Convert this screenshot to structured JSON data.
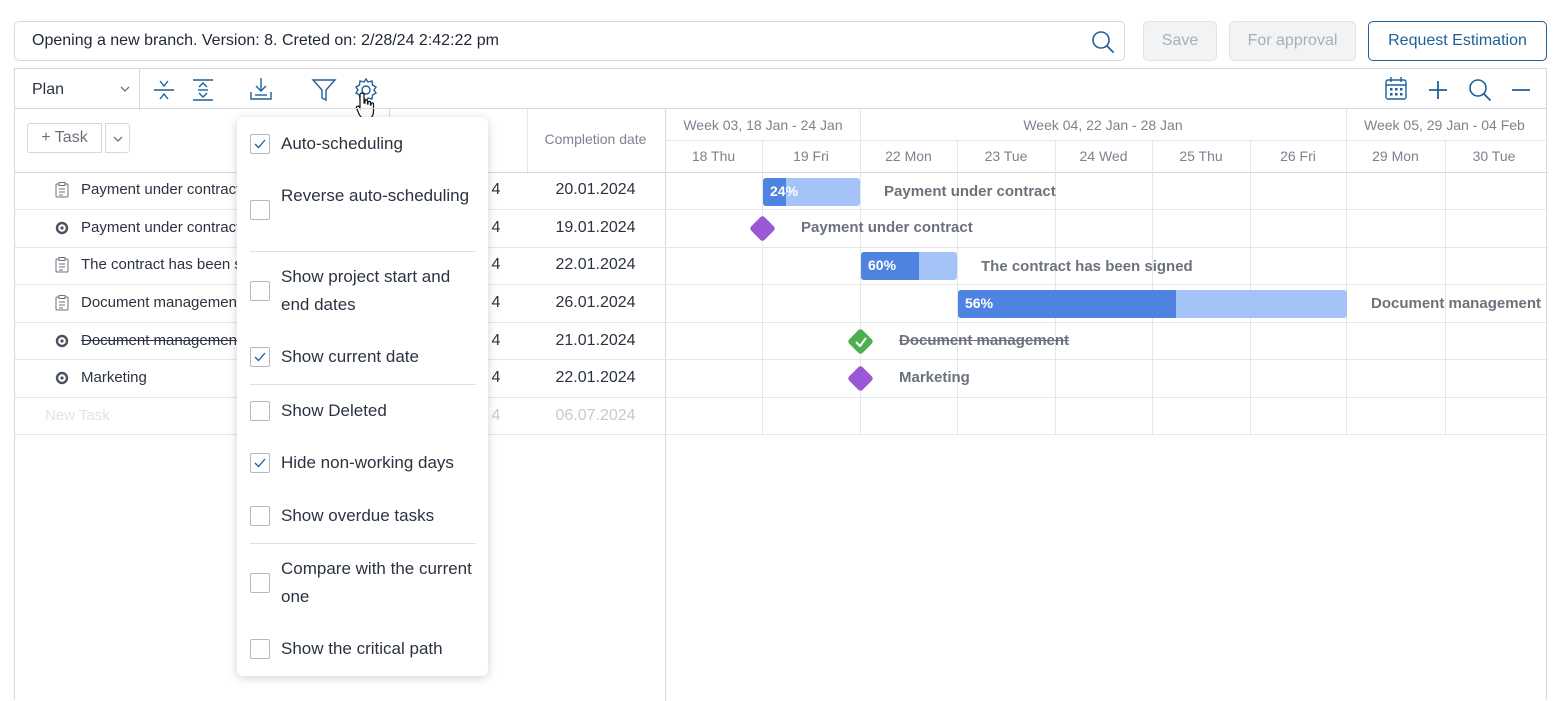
{
  "header": {
    "title_text": "Opening a new branch.  Version: 8.  Creted on: 2/28/24 2:42:22 pm",
    "save_label": "Save",
    "approval_label": "For approval",
    "estimation_label": "Request Estimation"
  },
  "toolbar": {
    "view_select": "Plan"
  },
  "table": {
    "add_task_label": "+ Task",
    "completion_header": "Completion date",
    "rows": [
      {
        "title": "Payment under contract",
        "icon": "task-icon",
        "start_tail": "4",
        "completion": "20.01.2024"
      },
      {
        "title": "Payment under contract",
        "icon": "milestone-icon",
        "start_tail": "4",
        "completion": "19.01.2024"
      },
      {
        "title": "The contract has been s",
        "icon": "task-icon",
        "start_tail": "4",
        "completion": "22.01.2024"
      },
      {
        "title": "Document managemen",
        "icon": "task-icon",
        "start_tail": "4",
        "completion": "26.01.2024"
      },
      {
        "title": "Document managemen",
        "icon": "milestone-icon",
        "start_tail": "4",
        "completion": "21.01.2024",
        "strike": true
      },
      {
        "title": "Marketing",
        "icon": "milestone-icon",
        "start_tail": "4",
        "completion": "22.01.2024"
      }
    ],
    "new_task": {
      "title": "New Task",
      "start_tail": "4",
      "completion": "06.07.2024"
    }
  },
  "gantt": {
    "weeks": [
      "Week 03, 18 Jan - 24 Jan",
      "Week 04, 22 Jan - 28 Jan",
      "Week 05, 29 Jan - 04 Feb"
    ],
    "days": [
      "18 Thu",
      "19 Fri",
      "22 Mon",
      "23 Tue",
      "24 Wed",
      "25 Thu",
      "26 Fri",
      "29 Mon",
      "30 Tue"
    ],
    "bars": [
      {
        "label": "Payment under contract",
        "percent": "24%",
        "progress": 0.24
      },
      {
        "label": "Payment under contract"
      },
      {
        "label": "The contract has been signed",
        "percent": "60%",
        "progress": 0.6
      },
      {
        "label": "Document management",
        "percent": "56%",
        "progress": 0.56
      },
      {
        "label": "Document management"
      },
      {
        "label": "Marketing"
      }
    ],
    "colors": {
      "bar_fill": "#4f83e1",
      "bar_bg": "#a4c4f7",
      "milestone": "#9a57d6",
      "done": "#4caf50"
    }
  },
  "settings_menu": {
    "items": [
      {
        "label": "Auto-scheduling",
        "checked": true
      },
      {
        "label": "Reverse auto-scheduling",
        "checked": false
      },
      {
        "label": "Show project start and end dates",
        "checked": false
      },
      {
        "label": "Show current date",
        "checked": true
      },
      {
        "label": "Show Deleted",
        "checked": false
      },
      {
        "label": "Hide non-working days",
        "checked": true
      },
      {
        "label": "Show overdue tasks",
        "checked": false
      },
      {
        "label": "Compare with the current one",
        "checked": false
      },
      {
        "label": "Show the critical path",
        "checked": false
      }
    ]
  }
}
